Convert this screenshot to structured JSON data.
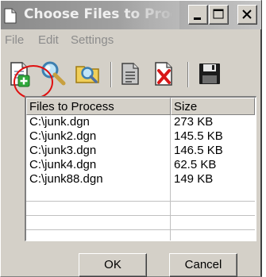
{
  "window": {
    "title": "Choose Files to Proce...",
    "controls": {
      "minimize_icon": "minimize-icon",
      "maximize_icon": "maximize-icon",
      "close_icon": "close-icon"
    }
  },
  "menu": {
    "items": [
      "File",
      "Edit",
      "Settings"
    ]
  },
  "toolbar": {
    "buttons": [
      "add-file-icon",
      "search-icon",
      "find-folder-icon",
      "document-icon",
      "delete-file-icon",
      "save-icon"
    ],
    "highlight_color": "#e01010"
  },
  "file_list": {
    "columns": [
      "Files to Process",
      "Size"
    ],
    "rows": [
      {
        "file": "C:\\junk.dgn",
        "size": "273 KB"
      },
      {
        "file": "C:\\junk2.dgn",
        "size": "145.5 KB"
      },
      {
        "file": "C:\\junk3.dgn",
        "size": "146.5 KB"
      },
      {
        "file": "C:\\junk4.dgn",
        "size": "62.5 KB"
      },
      {
        "file": "C:\\junk88.dgn",
        "size": "149 KB"
      }
    ]
  },
  "buttons": {
    "ok": "OK",
    "cancel": "Cancel"
  }
}
